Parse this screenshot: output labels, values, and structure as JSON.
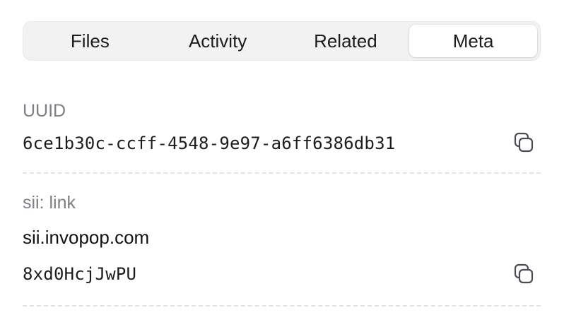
{
  "tabs": [
    {
      "label": "Files",
      "active": false
    },
    {
      "label": "Activity",
      "active": false
    },
    {
      "label": "Related",
      "active": false
    },
    {
      "label": "Meta",
      "active": true
    }
  ],
  "meta": {
    "uuid": {
      "label": "UUID",
      "value": "6ce1b30c-ccff-4548-9e97-a6ff6386db31",
      "copy_icon": "copy-icon"
    },
    "sii_link": {
      "label": "sii: link",
      "host": "sii.invopop.com",
      "code": "8xd0HcjJwPU",
      "copy_icon": "copy-icon"
    }
  },
  "colors": {
    "tab_bar_bg": "#f2f2f3",
    "label_gray": "#7c7f86",
    "text_dark": "#1c1c1e",
    "divider": "#e3e4e7"
  }
}
